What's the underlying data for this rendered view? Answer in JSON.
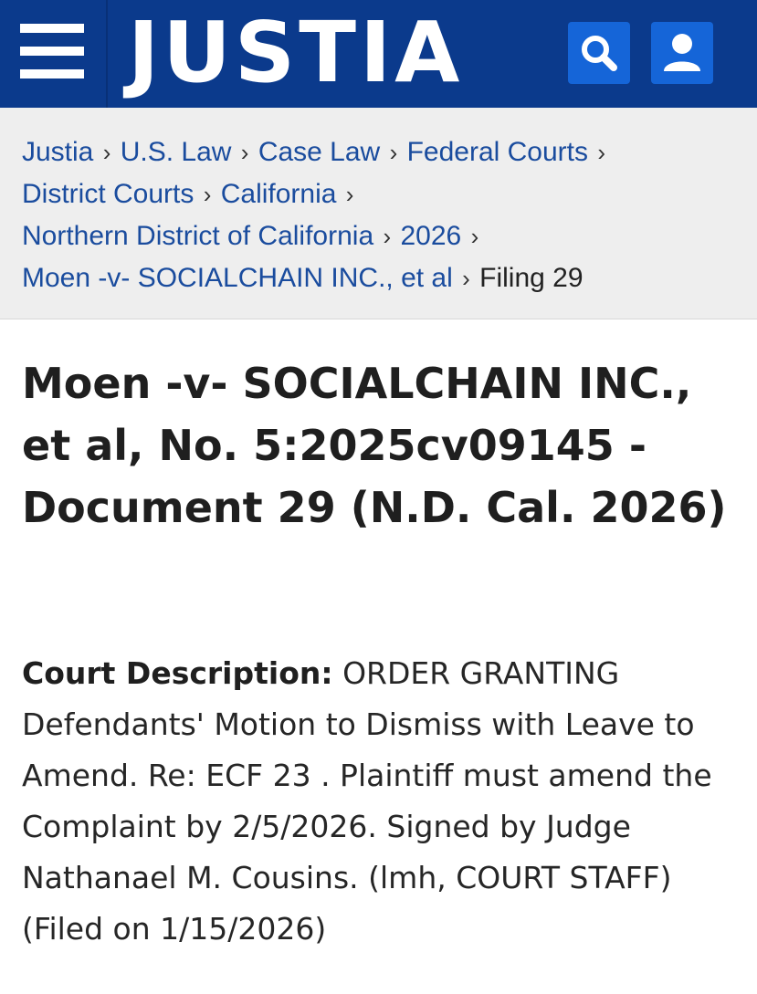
{
  "header": {
    "logo": "JUSTIA",
    "menu_icon": "hamburger-menu-icon",
    "search_icon": "search-icon",
    "user_icon": "user-icon",
    "background_color": "#0b3a8c",
    "icon_button_color": "#1565d8"
  },
  "breadcrumb": {
    "separator": "›",
    "items": [
      "Justia",
      "U.S. Law",
      "Case Law",
      "Federal Courts",
      "District Courts",
      "California",
      "Northern District of California",
      "2026",
      "Moen -v- SOCIALCHAIN INC., et al"
    ],
    "current": "Filing 29"
  },
  "document": {
    "title": "Moen -v- SOCIALCHAIN INC., et al, No. 5:2025cv09145 - Document 29 (N.D. Cal. 2026)",
    "description_label": "Court Description:",
    "description_text": "ORDER GRANTING Defendants' Motion to Dismiss with Leave to Amend. Re: ECF 23 . Plaintiff must amend the Complaint by 2/5/2026. Signed by Judge Nathanael M. Cousins. (lmh, COURT STAFF) (Filed on 1/15/2026)"
  }
}
